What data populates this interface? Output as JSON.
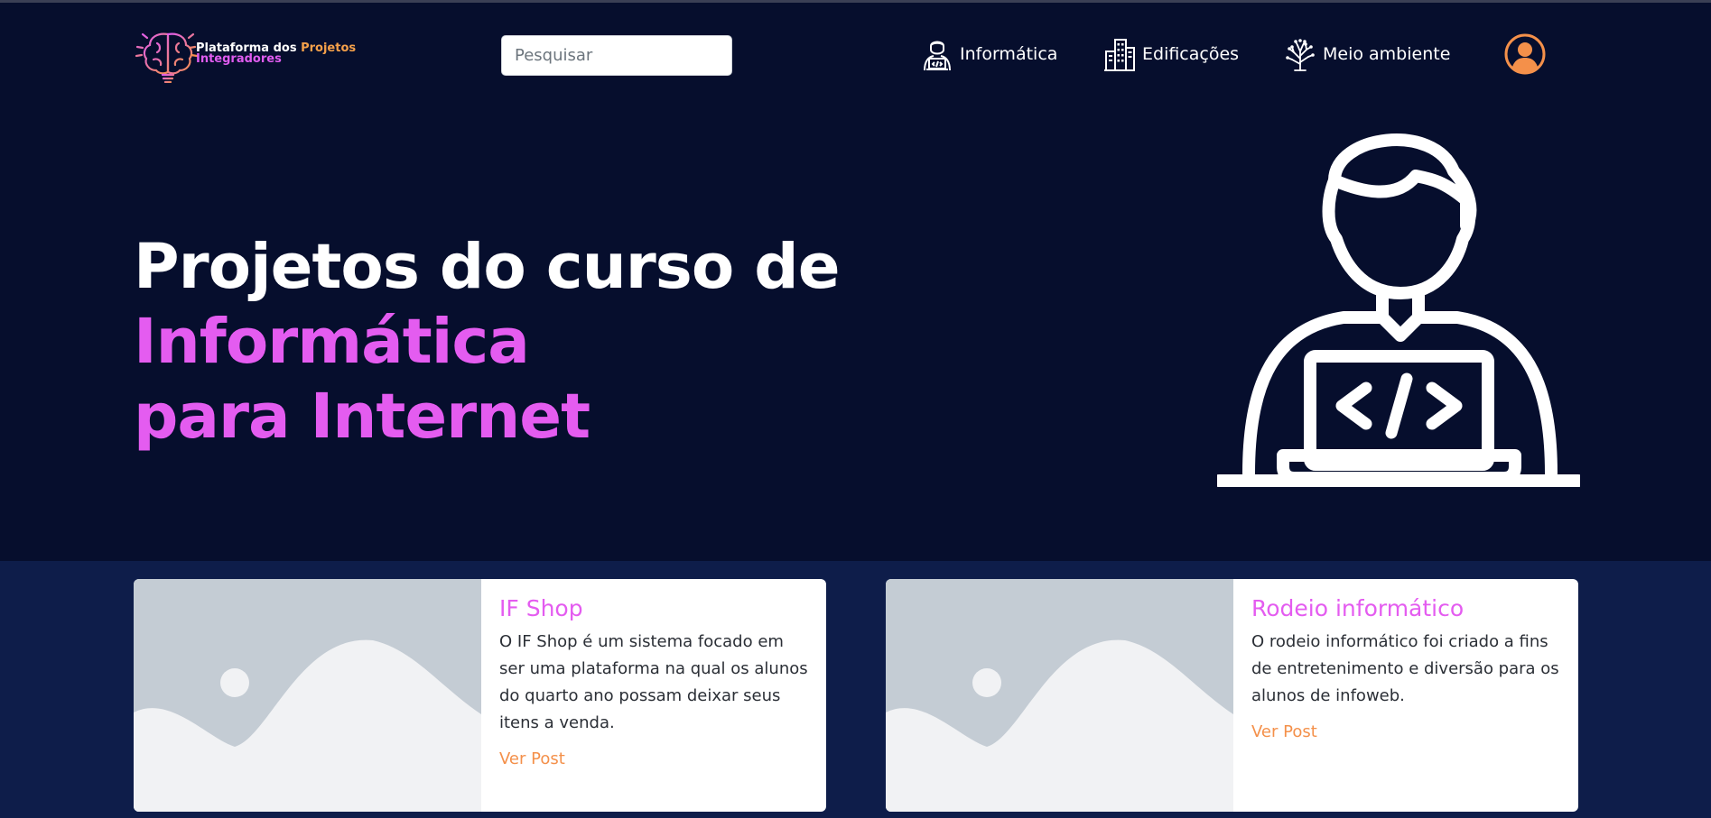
{
  "header": {
    "logo": {
      "line1_white": "Plataforma dos ",
      "line1_orange": "Projetos",
      "line2": "Integradores"
    },
    "search": {
      "placeholder": "Pesquisar"
    },
    "nav": [
      {
        "label": "Informática",
        "icon": "developer-icon"
      },
      {
        "label": "Edificações",
        "icon": "buildings-icon"
      },
      {
        "label": "Meio ambiente",
        "icon": "tree-icon"
      }
    ],
    "avatar_icon": "user-circle-icon"
  },
  "hero": {
    "title_white": "Projetos do curso de ",
    "title_accent_1": "Informática",
    "title_accent_2": "para Internet",
    "illustration_icon": "developer-laptop-icon"
  },
  "cards": [
    {
      "title": "IF Shop",
      "text": "O IF Shop é um sistema focado em ser uma plataforma na qual os alunos do quarto ano possam deixar seus itens a venda.",
      "link": "Ver Post",
      "image_icon": "image-placeholder-icon"
    },
    {
      "title": "Rodeio informático",
      "text": "O rodeio informático foi criado a fins de entretenimento e diversão para os alunos de infoweb.",
      "link": "Ver Post",
      "image_icon": "image-placeholder-icon"
    }
  ],
  "colors": {
    "background": "#060e2d",
    "lower_background": "#0e1d4a",
    "accent_pink": "#e45cf0",
    "accent_orange": "#f4904a",
    "text_white": "#ffffff"
  }
}
